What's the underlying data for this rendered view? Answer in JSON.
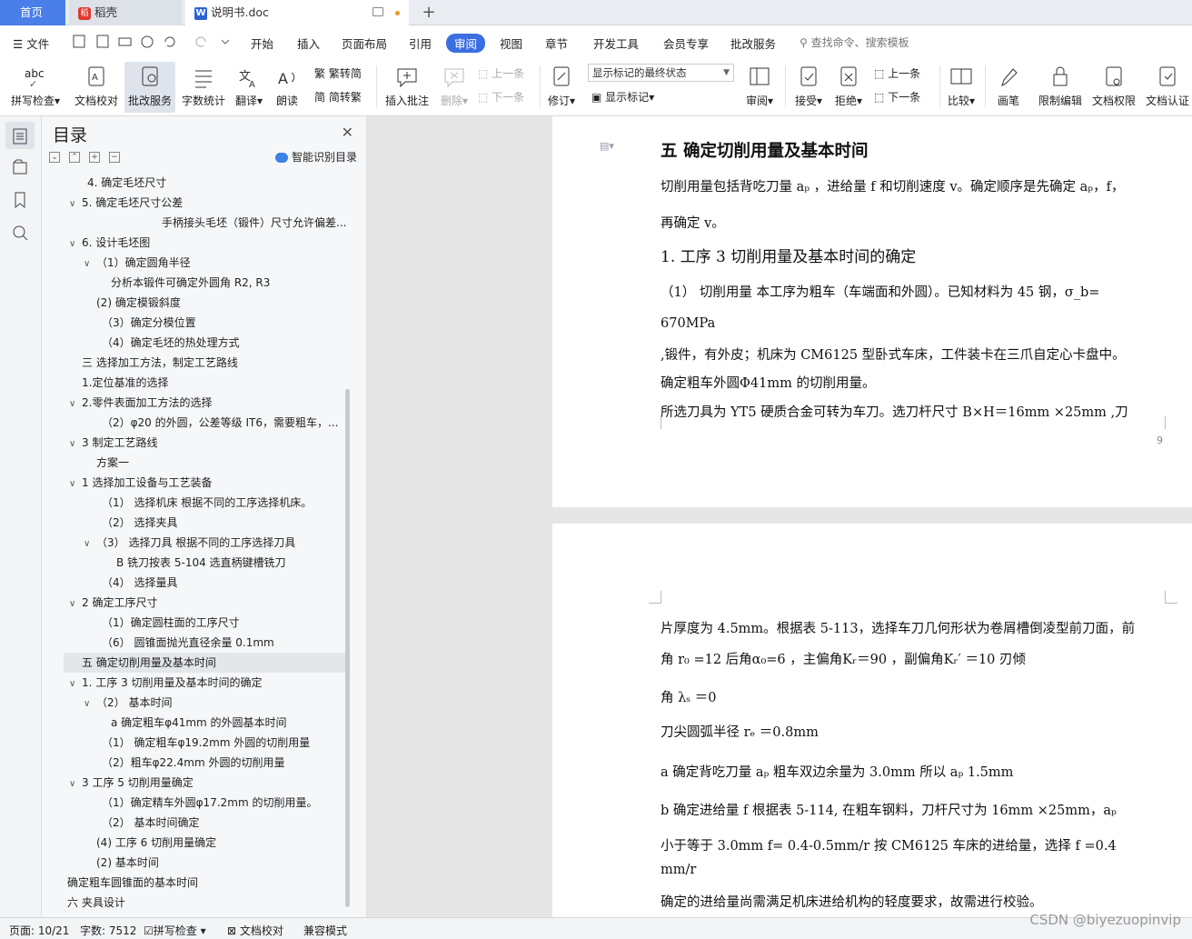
{
  "tabs": {
    "home": "首页",
    "daoke": "稻壳",
    "doc": "说明书.doc"
  },
  "menu": {
    "file": "文件",
    "items": [
      "开始",
      "插入",
      "页面布局",
      "引用",
      "审阅",
      "视图",
      "章节",
      "开发工具",
      "会员专享",
      "批改服务"
    ],
    "active": "审阅",
    "search": "查找命令、搜索模板"
  },
  "ribbon": {
    "spell": "拼写检查",
    "proof": "文档校对",
    "review_service": "批改服务",
    "wordcount": "字数统计",
    "translate": "翻译",
    "read": "朗读",
    "trad": "繁转简",
    "simp": "简转繁",
    "insert_comment": "插入批注",
    "delete": "删除",
    "prev": "上一条",
    "next": "下一条",
    "revise": "修订",
    "markup_state": "显示标记的最终状态",
    "show_markup": "显示标记",
    "review": "审阅",
    "accept": "接受",
    "reject": "拒绝",
    "prev2": "上一条",
    "next2": "下一条",
    "compare": "比较",
    "pen": "画笔",
    "restrict": "限制编辑",
    "perm": "文档权限",
    "cert": "文档认证"
  },
  "toc": {
    "title": "目录",
    "smart": "智能识别目录",
    "items": [
      {
        "text": "4.   确定毛坯尺寸",
        "indent": 50,
        "chev": ""
      },
      {
        "text": "5. 确定毛坯尺寸公差",
        "indent": 30,
        "chev": "∨"
      },
      {
        "text": "手柄接头毛坯（锻件）尺寸允许偏差...",
        "indent": 132,
        "chev": ""
      },
      {
        "text": "6.   设计毛坯图",
        "indent": 30,
        "chev": "∨"
      },
      {
        "text": "（1）确定圆角半径",
        "indent": 46,
        "chev": "∨"
      },
      {
        "text": "分析本锻件可确定外圆角 R2, R3",
        "indent": 76,
        "chev": ""
      },
      {
        "text": "(2) 确定模锻斜度",
        "indent": 60,
        "chev": ""
      },
      {
        "text": "（3）确定分模位置",
        "indent": 66,
        "chev": ""
      },
      {
        "text": "（4）确定毛坯的热处理方式",
        "indent": 66,
        "chev": ""
      },
      {
        "text": "三  选择加工方法，制定工艺路线",
        "indent": 44,
        "chev": ""
      },
      {
        "text": "1.定位基准的选择",
        "indent": 44,
        "chev": ""
      },
      {
        "text": "2.零件表面加工方法的选择",
        "indent": 30,
        "chev": "∨"
      },
      {
        "text": "（2）φ20 的外圆，公差等级 IT6，需要粗车，...",
        "indent": 66,
        "chev": ""
      },
      {
        "text": "3 制定工艺路线",
        "indent": 30,
        "chev": "∨"
      },
      {
        "text": "方案一",
        "indent": 60,
        "chev": ""
      },
      {
        "text": "1  选择加工设备与工艺装备",
        "indent": 30,
        "chev": "∨"
      },
      {
        "text": "（1）  选择机床  根据不同的工序选择机床。",
        "indent": 66,
        "chev": ""
      },
      {
        "text": "（2）  选择夹具",
        "indent": 66,
        "chev": ""
      },
      {
        "text": "（3）    选择刀具    根据不同的工序选择刀具",
        "indent": 46,
        "chev": "∨"
      },
      {
        "text": "B    铣刀按表 5-104 选直柄键槽铣刀",
        "indent": 82,
        "chev": ""
      },
      {
        "text": "（4）    选择量具",
        "indent": 66,
        "chev": ""
      },
      {
        "text": "2  确定工序尺寸",
        "indent": 30,
        "chev": "∨"
      },
      {
        "text": "（1）确定圆柱面的工序尺寸",
        "indent": 66,
        "chev": ""
      },
      {
        "text": "（6）    圆锥面抛光直径余量   0.1mm",
        "indent": 66,
        "chev": ""
      },
      {
        "text": "五  确定切削用量及基本时间",
        "indent": 44,
        "chev": "",
        "current": true
      },
      {
        "text": "1.  工序 3 切削用量及基本时间的确定",
        "indent": 30,
        "chev": "∨"
      },
      {
        "text": "（2）    基本时间",
        "indent": 46,
        "chev": "∨"
      },
      {
        "text": "a    确定粗车φ41mm 的外圆基本时间",
        "indent": 76,
        "chev": ""
      },
      {
        "text": "（1）      确定粗车φ19.2mm    外圆的切削用量",
        "indent": 66,
        "chev": ""
      },
      {
        "text": "（2）粗车φ22.4mm 外圆的切削用量",
        "indent": 66,
        "chev": ""
      },
      {
        "text": "3      工序 5 切削用量确定",
        "indent": 30,
        "chev": "∨"
      },
      {
        "text": "（1）确定精车外圆φ17.2mm 的切削用量。",
        "indent": 66,
        "chev": ""
      },
      {
        "text": "（2）     基本时间确定",
        "indent": 66,
        "chev": ""
      },
      {
        "text": "(4)    工序 6 切削用量确定",
        "indent": 60,
        "chev": ""
      },
      {
        "text": "(2)  基本时间",
        "indent": 60,
        "chev": ""
      },
      {
        "text": "确定粗车圆锥面的基本时间",
        "indent": 28,
        "chev": ""
      },
      {
        "text": "六      夹具设计",
        "indent": 28,
        "chev": ""
      }
    ]
  },
  "page1": {
    "heading": "五  确定切削用量及基本时间",
    "lines": [
      "切削用量包括背吃刀量 aₚ ，进给量 f 和切削速度 v。确定顺序是先确定 aₚ，f，",
      "再确定 v。",
      "（1）   切削用量    本工序为粗车（车端面和外圆）。已知材料为 45 钢，σ_b=",
      "670MPa",
      ",锻件，有外皮；机床为 CM6125 型卧式车床，工件装卡在三爪自定心卡盘中。",
      "确定粗车外圆Φ41mm 的切削用量。",
      "所选刀具为 YT5 硬质合金可转为车刀。选刀杆尺寸 B×H＝16mm   ×25mm ,刀"
    ],
    "subheading": "1. 工序 3 切削用量及基本时间的确定",
    "page_no": "9"
  },
  "page2": {
    "lines": [
      "片厚度为 4.5mm。根据表 5-113，选择车刀几何形状为卷屑槽倒凌型前刀面，前",
      "角 r₀ =12  后角α₀=6 ，主偏角Kᵣ＝90      ，副偏角Kᵣ′ ＝10                    刃倾",
      "角 λₛ   ＝0",
      "刀尖圆弧半径 rₑ ＝0.8mm",
      "a      确定背吃刀量 aₚ       粗车双边余量为 3.0mm  所以  aₚ 1.5mm",
      "b      确定进给量 f    根据表 5-114, 在粗车钢料，刀杆尺寸为 16mm   ×25mm，aₚ",
      "小于等于 3.0mm       f= 0.4-0.5mm/r        按 CM6125 车床的进给量，选择 f =0.4",
      "mm/r",
      "确定的进给量尚需满足机床进给机构的轻度要求，故需进行校验。"
    ]
  },
  "status": {
    "page": "页面: 10/21",
    "words": "字数: 7512",
    "spell": "拼写检查",
    "proof": "文档校对",
    "compat": "兼容模式"
  },
  "watermark": "CSDN @biyezuopinvip",
  "colors": {
    "accent": "#3b6ee0",
    "home_tab": "#4a7ee8"
  }
}
